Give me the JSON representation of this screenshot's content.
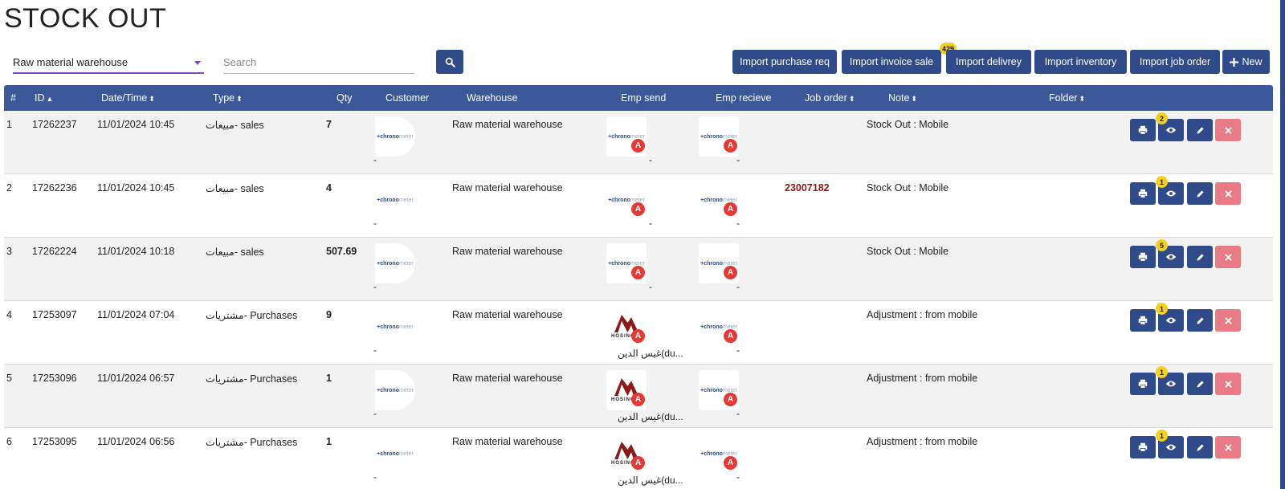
{
  "page": {
    "title": "STOCK OUT"
  },
  "filters": {
    "warehouse": "Raw material warehouse",
    "search_placeholder": "Search"
  },
  "toolbar": {
    "import_purchase_req": "Import purchase req",
    "import_invoice_sale": "Import invoice sale",
    "import_invoice_sale_badge": "429",
    "import_delivery": "Import delivrey",
    "import_inventory": "Import inventory",
    "import_job_order": "Import job order",
    "new": "New"
  },
  "table": {
    "headers": {
      "num": "#",
      "id": "ID",
      "datetime": "Date/Time",
      "type": "Type",
      "qty": "Qty",
      "customer": "Customer",
      "warehouse": "Warehouse",
      "emp_send": "Emp send",
      "emp_receive": "Emp recieve",
      "job_order": "Job order",
      "note": "Note",
      "folder": "Folder"
    },
    "logo_text": {
      "chrono": "+chrono",
      "meter": "meter",
      "hosino": "HOSINO"
    },
    "a_badge": "A",
    "dash": "-",
    "rows": [
      {
        "num": "1",
        "id": "17262237",
        "datetime": "11/01/2024 10:45",
        "type": "مبيعات- sales",
        "qty": "7",
        "warehouse": "Raw material warehouse",
        "job_order": "",
        "note": "Stock Out : Mobile",
        "view_badge": "2",
        "emp_send_name": "-"
      },
      {
        "num": "2",
        "id": "17262236",
        "datetime": "11/01/2024 10:45",
        "type": "مبيعات- sales",
        "qty": "4",
        "warehouse": "Raw material warehouse",
        "job_order": "23007182",
        "note": "Stock Out : Mobile",
        "view_badge": "1",
        "emp_send_name": "-"
      },
      {
        "num": "3",
        "id": "17262224",
        "datetime": "11/01/2024 10:18",
        "type": "مبيعات- sales",
        "qty": "507.69",
        "warehouse": "Raw material warehouse",
        "job_order": "",
        "note": "Stock Out : Mobile",
        "view_badge": "5",
        "emp_send_name": "-"
      },
      {
        "num": "4",
        "id": "17253097",
        "datetime": "11/01/2024 07:04",
        "type": "مشتريات- Purchases",
        "qty": "9",
        "warehouse": "Raw material warehouse",
        "job_order": "",
        "note": "Adjustment : from mobile",
        "view_badge": "1",
        "emp_send_name": "غيس الدين(du..."
      },
      {
        "num": "5",
        "id": "17253096",
        "datetime": "11/01/2024 06:57",
        "type": "مشتريات- Purchases",
        "qty": "1",
        "warehouse": "Raw material warehouse",
        "job_order": "",
        "note": "Adjustment : from mobile",
        "view_badge": "1",
        "emp_send_name": "غيس الدين(du..."
      },
      {
        "num": "6",
        "id": "17253095",
        "datetime": "11/01/2024 06:56",
        "type": "مشتريات- Purchases",
        "qty": "1",
        "warehouse": "Raw material warehouse",
        "job_order": "",
        "note": "Adjustment : from mobile",
        "view_badge": "1",
        "emp_send_name": "غيس الدين(du..."
      }
    ]
  },
  "colors": {
    "primary": "#2f4b8a",
    "header": "#3b5998",
    "badge": "#f5d020",
    "danger_badge": "#e53935",
    "delete": "#e97b86",
    "job_order": "#8b1a1a"
  }
}
